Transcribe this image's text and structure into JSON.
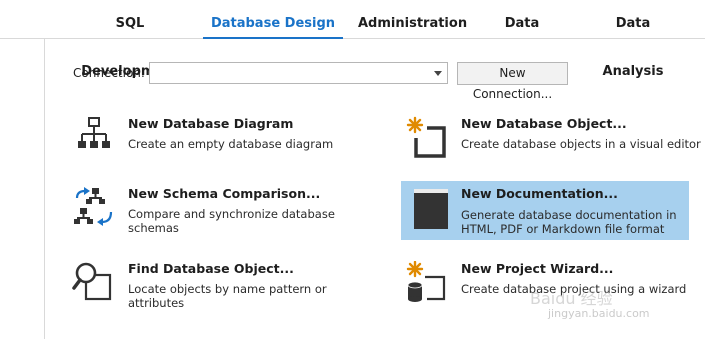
{
  "tabs": [
    {
      "label": "SQL Development",
      "active": false
    },
    {
      "label": "Database Design",
      "active": true
    },
    {
      "label": "Administration",
      "active": false
    },
    {
      "label": "Data Pump",
      "active": false
    },
    {
      "label": "Data Analysis",
      "active": false
    }
  ],
  "connection": {
    "label": "Connection:",
    "selected_value": "",
    "new_button_label": "New Connection..."
  },
  "items": [
    {
      "title": "New Database Diagram",
      "description": "Create an empty database diagram",
      "icon": "diagram-icon"
    },
    {
      "title": "New Database Object...",
      "description": "Create database objects in a visual editor",
      "icon": "new-object-icon"
    },
    {
      "title": "New Schema Comparison...",
      "description": "Compare and synchronize database schemas",
      "icon": "schema-compare-icon"
    },
    {
      "title": "New Documentation...",
      "description": "Generate database documentation in HTML, PDF or Markdown file format",
      "icon": "documentation-icon",
      "selected": true
    },
    {
      "title": "Find Database Object...",
      "description": "Locate objects by name pattern or attributes",
      "icon": "find-icon"
    },
    {
      "title": "New Project Wizard...",
      "description": "Create database project using a wizard",
      "icon": "project-wizard-icon"
    }
  ],
  "watermark": {
    "text": "Baidu 经验",
    "url": "jingyan.baidu.com"
  },
  "colors": {
    "accent": "#1a73c8",
    "selection": "#a7d0ee",
    "icon_orange": "#e08a00",
    "icon_dark": "#333333"
  }
}
